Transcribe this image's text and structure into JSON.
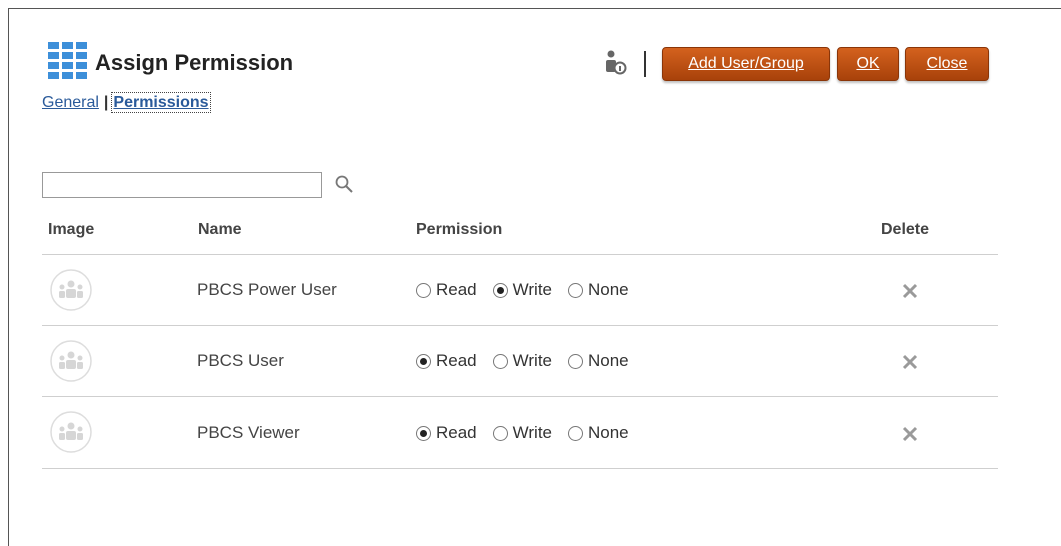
{
  "header": {
    "title": "Assign Permission",
    "icon": "grid-icon",
    "accent_color": "#3d8fd9"
  },
  "subnav": {
    "general_label": "General",
    "separator": "|",
    "permissions_label": "Permissions"
  },
  "toolbar": {
    "person_icon": "user-info-icon",
    "add_label": "Add User/Group",
    "ok_label": "OK",
    "close_label": "Close",
    "button_color": "#c1551a"
  },
  "search": {
    "value": "",
    "icon": "search-icon"
  },
  "table": {
    "columns": [
      "Image",
      "Name",
      "Permission",
      "Delete"
    ],
    "permission_options": [
      "Read",
      "Write",
      "None"
    ],
    "rows": [
      {
        "name": "PBCS Power User",
        "permission": "Write"
      },
      {
        "name": "PBCS User",
        "permission": "Read"
      },
      {
        "name": "PBCS Viewer",
        "permission": "Read"
      }
    ]
  }
}
